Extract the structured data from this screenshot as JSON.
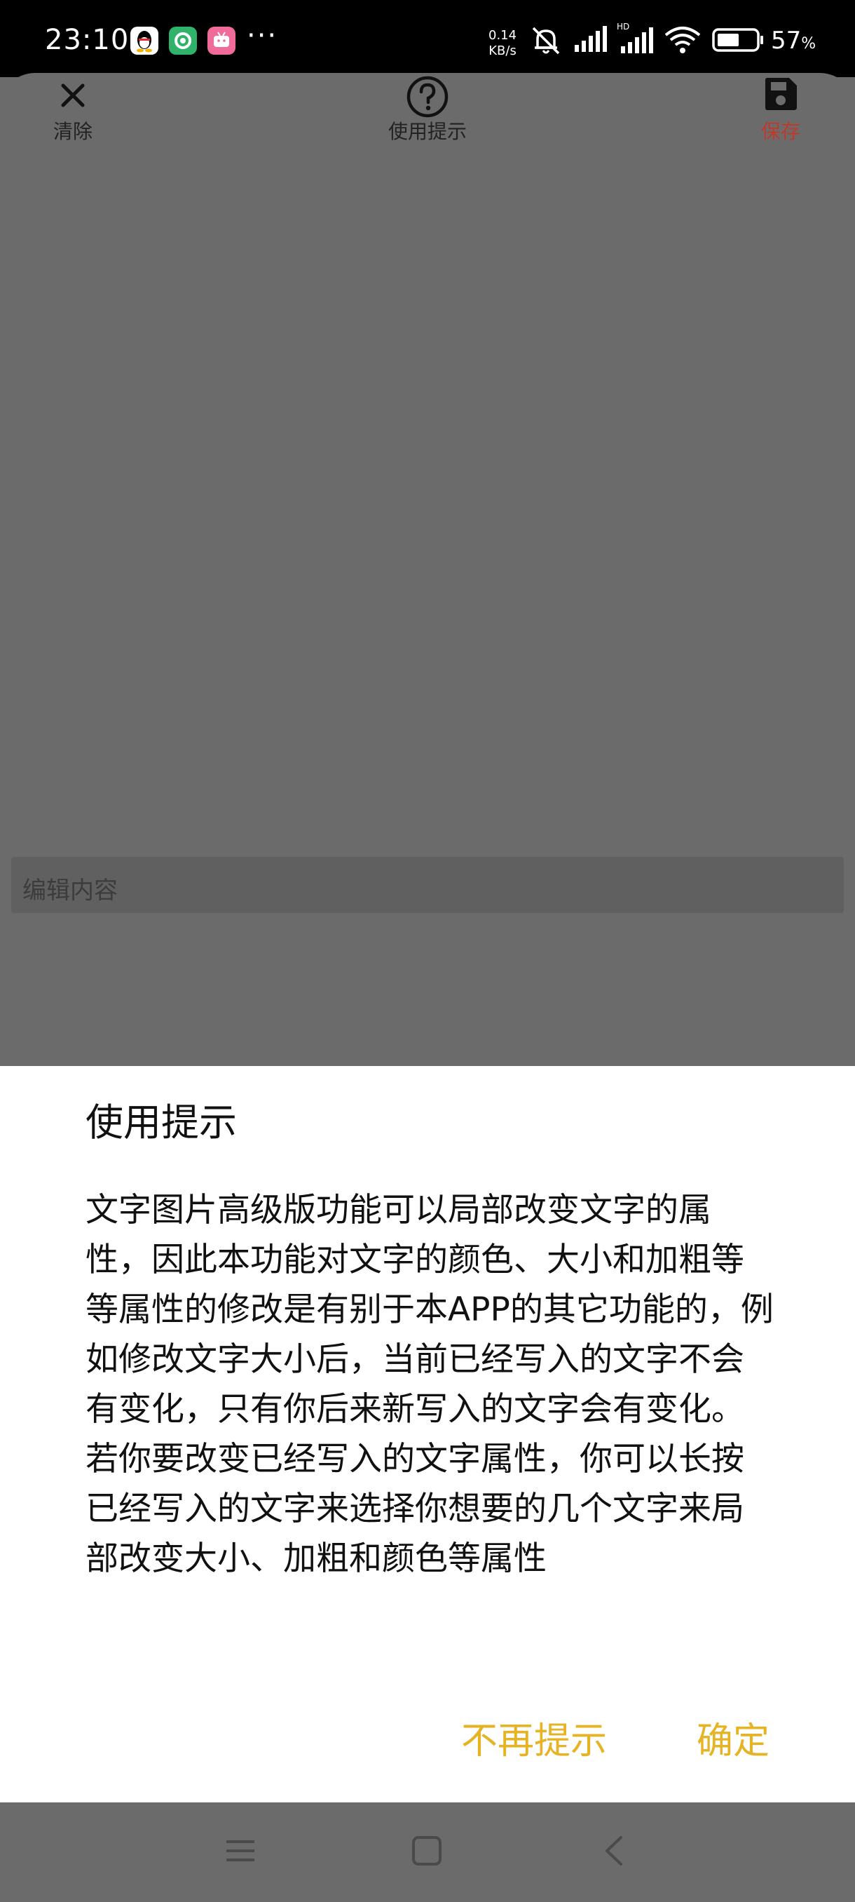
{
  "status_bar": {
    "time": "23:10",
    "app_icons": [
      "qq-icon",
      "green-circle-app-icon",
      "pink-tv-app-icon"
    ],
    "more": "···",
    "net_speed_value": "0.14",
    "net_speed_unit": "KB/s",
    "battery_value": "57",
    "battery_unit": "%",
    "battery_level": 0.57
  },
  "toolbar": {
    "clear_label": "清除",
    "help_label": "使用提示",
    "save_label": "保存",
    "save_color": "#c0392b"
  },
  "editor": {
    "placeholder": "编辑内容"
  },
  "dialog": {
    "title": "使用提示",
    "body": "文字图片高级版功能可以局部改变文字的属性，因此本功能对文字的颜色、大小和加粗等等属性的修改是有别于本APP的其它功能的，例如修改文字大小后，当前已经写入的文字不会有变化，只有你后来新写入的文字会有变化。若你要改变已经写入的文字属性，你可以长按已经写入的文字来选择你想要的几个文字来局部改变大小、加粗和颜色等属性",
    "dont_show_label": "不再提示",
    "ok_label": "确定",
    "accent_color": "#e6b325"
  },
  "nav_bar": {
    "icons": [
      "menu-icon",
      "home-icon",
      "back-icon"
    ]
  }
}
